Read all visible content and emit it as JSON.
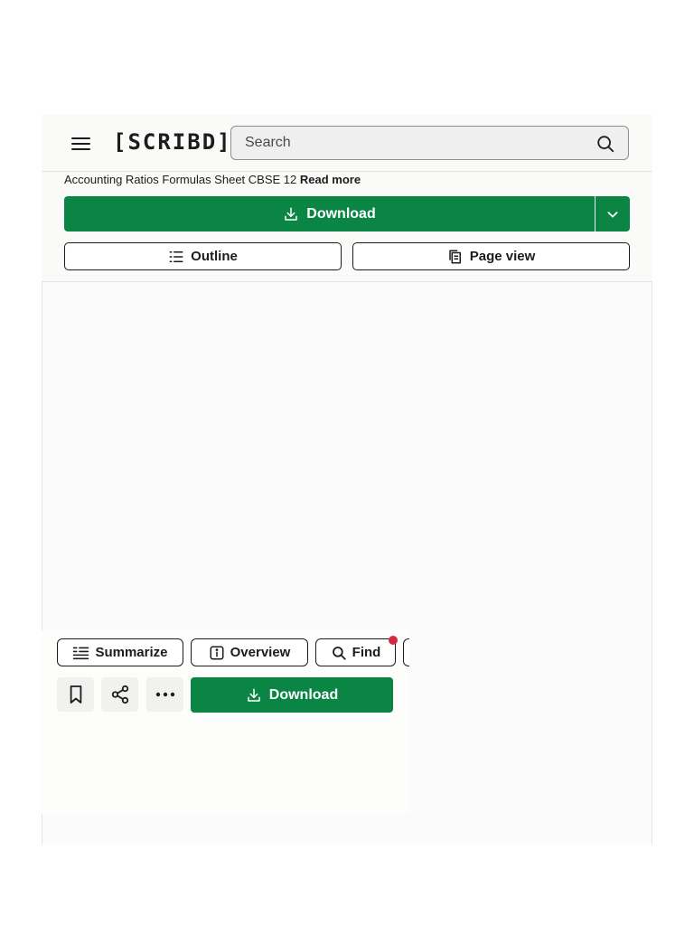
{
  "header": {
    "logo_text": "[SCRIBD]",
    "search": {
      "placeholder": "Search",
      "value": ""
    }
  },
  "document": {
    "title": "Accounting Ratios Formulas Sheet CBSE 12",
    "read_more": "Read more"
  },
  "actions": {
    "download_label": "Download",
    "outline_label": "Outline",
    "page_view_label": "Page view"
  },
  "toolbar": {
    "summarize_label": "Summarize",
    "overview_label": "Overview",
    "find_label": "Find",
    "download_label": "Download"
  },
  "colors": {
    "brand_green": "#0a8543",
    "notification_red": "#d6283e",
    "frame_background": "#fafaf8"
  }
}
